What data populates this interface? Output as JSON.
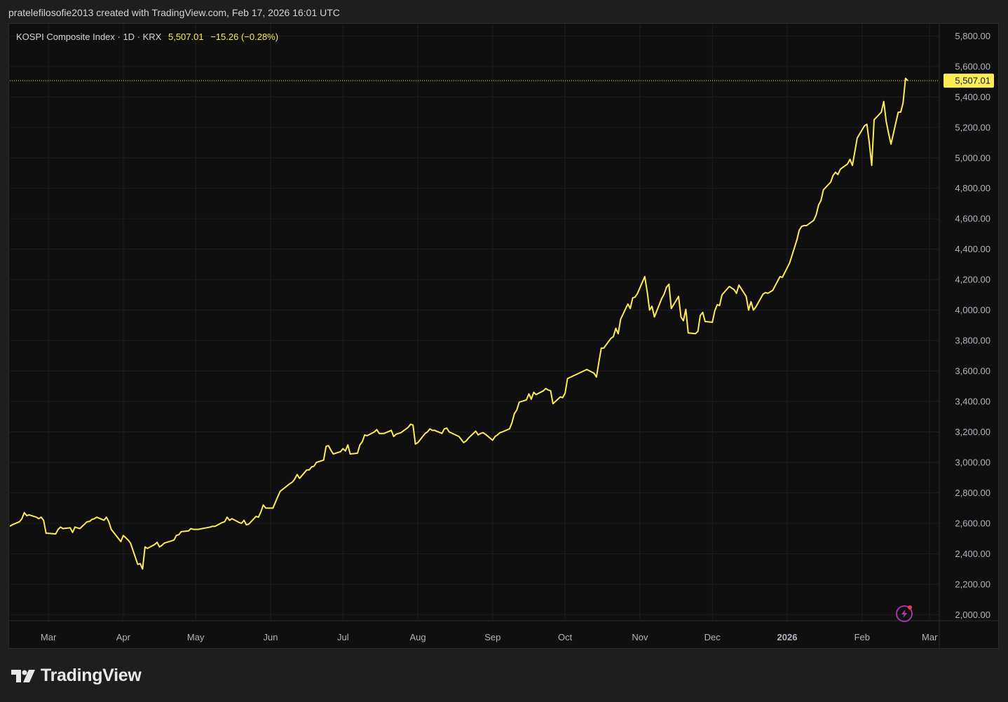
{
  "header": {
    "credit": "pratelefilosofie2013 created with TradingView.com, Feb 17, 2026 16:01 UTC"
  },
  "legend": {
    "symbol": "KOSPI Composite Index · 1D · KRX",
    "last": "5,507.01",
    "change": "−15.26 (−0.28%)"
  },
  "footer": {
    "brand": "TradingView"
  },
  "colors": {
    "line": "#fbeb55",
    "background": "#0f0f0f",
    "grid": "#1f1f1f",
    "axis_text": "#b2b5be",
    "tag_bg": "#fbeb55"
  },
  "icons": {
    "alert": "lightning-bolt-icon"
  },
  "chart_data": {
    "type": "line",
    "title": "KOSPI Composite Index · 1D · KRX",
    "ylim": [
      1960,
      5880
    ],
    "xlim": [
      "2025-02-13",
      "2026-03-05"
    ],
    "y_ticks": [
      2000,
      2200,
      2400,
      2600,
      2800,
      3000,
      3200,
      3400,
      3600,
      3800,
      4000,
      4200,
      4400,
      4600,
      4800,
      5000,
      5200,
      5400,
      5600,
      5800
    ],
    "y_tick_labels": [
      "2,000.00",
      "2,200.00",
      "2,400.00",
      "2,600.00",
      "2,800.00",
      "3,000.00",
      "3,200.00",
      "3,400.00",
      "3,600.00",
      "3,800.00",
      "4,000.00",
      "4,200.00",
      "4,400.00",
      "4,600.00",
      "4,800.00",
      "5,000.00",
      "5,200.00",
      "5,400.00",
      "5,600.00",
      "5,800.00"
    ],
    "x_ticks": [
      {
        "date": "2025-03-01",
        "label": "Mar"
      },
      {
        "date": "2025-04-01",
        "label": "Apr"
      },
      {
        "date": "2025-05-01",
        "label": "May"
      },
      {
        "date": "2025-06-01",
        "label": "Jun"
      },
      {
        "date": "2025-07-01",
        "label": "Jul"
      },
      {
        "date": "2025-08-01",
        "label": "Aug"
      },
      {
        "date": "2025-09-01",
        "label": "Sep"
      },
      {
        "date": "2025-10-01",
        "label": "Oct"
      },
      {
        "date": "2025-11-01",
        "label": "Nov"
      },
      {
        "date": "2025-12-01",
        "label": "Dec"
      },
      {
        "date": "2026-01-01",
        "label": "2026",
        "bold": true
      },
      {
        "date": "2026-02-01",
        "label": "Feb"
      },
      {
        "date": "2026-03-01",
        "label": "Mar"
      }
    ],
    "last_value": 5507.01,
    "last_value_label": "5,507.01",
    "grid": true,
    "series": [
      {
        "points": [
          [
            "2025-02-13",
            2580
          ],
          [
            "2025-02-14",
            2590
          ],
          [
            "2025-02-17",
            2610
          ],
          [
            "2025-02-18",
            2630
          ],
          [
            "2025-02-19",
            2670
          ],
          [
            "2025-02-20",
            2650
          ],
          [
            "2025-02-21",
            2655
          ],
          [
            "2025-02-24",
            2640
          ],
          [
            "2025-02-25",
            2630
          ],
          [
            "2025-02-26",
            2640
          ],
          [
            "2025-02-27",
            2620
          ],
          [
            "2025-02-28",
            2535
          ],
          [
            "2025-03-04",
            2530
          ],
          [
            "2025-03-05",
            2560
          ],
          [
            "2025-03-06",
            2575
          ],
          [
            "2025-03-07",
            2565
          ],
          [
            "2025-03-10",
            2570
          ],
          [
            "2025-03-11",
            2540
          ],
          [
            "2025-03-12",
            2575
          ],
          [
            "2025-03-13",
            2570
          ],
          [
            "2025-03-14",
            2565
          ],
          [
            "2025-03-17",
            2610
          ],
          [
            "2025-03-18",
            2612
          ],
          [
            "2025-03-19",
            2625
          ],
          [
            "2025-03-20",
            2630
          ],
          [
            "2025-03-21",
            2640
          ],
          [
            "2025-03-24",
            2620
          ],
          [
            "2025-03-25",
            2640
          ],
          [
            "2025-03-26",
            2610
          ],
          [
            "2025-03-27",
            2560
          ],
          [
            "2025-03-28",
            2540
          ],
          [
            "2025-03-31",
            2480
          ],
          [
            "2025-04-01",
            2520
          ],
          [
            "2025-04-02",
            2505
          ],
          [
            "2025-04-03",
            2490
          ],
          [
            "2025-04-04",
            2470
          ],
          [
            "2025-04-07",
            2330
          ],
          [
            "2025-04-08",
            2335
          ],
          [
            "2025-04-09",
            2300
          ],
          [
            "2025-04-10",
            2445
          ],
          [
            "2025-04-11",
            2435
          ],
          [
            "2025-04-14",
            2460
          ],
          [
            "2025-04-15",
            2475
          ],
          [
            "2025-04-16",
            2445
          ],
          [
            "2025-04-17",
            2455
          ],
          [
            "2025-04-18",
            2470
          ],
          [
            "2025-04-21",
            2485
          ],
          [
            "2025-04-22",
            2490
          ],
          [
            "2025-04-23",
            2520
          ],
          [
            "2025-04-24",
            2525
          ],
          [
            "2025-04-25",
            2545
          ],
          [
            "2025-04-28",
            2550
          ],
          [
            "2025-04-29",
            2565
          ],
          [
            "2025-04-30",
            2560
          ],
          [
            "2025-05-02",
            2560
          ],
          [
            "2025-05-07",
            2575
          ],
          [
            "2025-05-08",
            2580
          ],
          [
            "2025-05-09",
            2580
          ],
          [
            "2025-05-12",
            2605
          ],
          [
            "2025-05-13",
            2610
          ],
          [
            "2025-05-14",
            2640
          ],
          [
            "2025-05-15",
            2620
          ],
          [
            "2025-05-16",
            2630
          ],
          [
            "2025-05-19",
            2605
          ],
          [
            "2025-05-20",
            2600
          ],
          [
            "2025-05-21",
            2620
          ],
          [
            "2025-05-22",
            2590
          ],
          [
            "2025-05-23",
            2595
          ],
          [
            "2025-05-26",
            2645
          ],
          [
            "2025-05-27",
            2640
          ],
          [
            "2025-05-28",
            2675
          ],
          [
            "2025-05-29",
            2720
          ],
          [
            "2025-05-30",
            2700
          ],
          [
            "2025-06-02",
            2700
          ],
          [
            "2025-06-04",
            2775
          ],
          [
            "2025-06-05",
            2810
          ],
          [
            "2025-06-09",
            2860
          ],
          [
            "2025-06-10",
            2870
          ],
          [
            "2025-06-11",
            2890
          ],
          [
            "2025-06-12",
            2920
          ],
          [
            "2025-06-13",
            2895
          ],
          [
            "2025-06-16",
            2950
          ],
          [
            "2025-06-17",
            2950
          ],
          [
            "2025-06-18",
            2970
          ],
          [
            "2025-06-19",
            2975
          ],
          [
            "2025-06-20",
            3000
          ],
          [
            "2025-06-23",
            3015
          ],
          [
            "2025-06-24",
            3105
          ],
          [
            "2025-06-25",
            3110
          ],
          [
            "2025-06-26",
            3080
          ],
          [
            "2025-06-27",
            3055
          ],
          [
            "2025-06-30",
            3070
          ],
          [
            "2025-07-01",
            3090
          ],
          [
            "2025-07-02",
            3075
          ],
          [
            "2025-07-03",
            3115
          ],
          [
            "2025-07-04",
            3055
          ],
          [
            "2025-07-07",
            3060
          ],
          [
            "2025-07-08",
            3115
          ],
          [
            "2025-07-09",
            3135
          ],
          [
            "2025-07-10",
            3180
          ],
          [
            "2025-07-11",
            3175
          ],
          [
            "2025-07-14",
            3200
          ],
          [
            "2025-07-15",
            3215
          ],
          [
            "2025-07-16",
            3190
          ],
          [
            "2025-07-17",
            3190
          ],
          [
            "2025-07-18",
            3190
          ],
          [
            "2025-07-21",
            3210
          ],
          [
            "2025-07-22",
            3170
          ],
          [
            "2025-07-23",
            3185
          ],
          [
            "2025-07-24",
            3190
          ],
          [
            "2025-07-25",
            3195
          ],
          [
            "2025-07-28",
            3230
          ],
          [
            "2025-07-29",
            3250
          ],
          [
            "2025-07-30",
            3245
          ],
          [
            "2025-07-31",
            3120
          ],
          [
            "2025-08-01",
            3130
          ],
          [
            "2025-08-04",
            3190
          ],
          [
            "2025-08-05",
            3200
          ],
          [
            "2025-08-06",
            3220
          ],
          [
            "2025-08-07",
            3210
          ],
          [
            "2025-08-08",
            3210
          ],
          [
            "2025-08-11",
            3190
          ],
          [
            "2025-08-12",
            3220
          ],
          [
            "2025-08-13",
            3225
          ],
          [
            "2025-08-14",
            3200
          ],
          [
            "2025-08-18",
            3170
          ],
          [
            "2025-08-19",
            3150
          ],
          [
            "2025-08-20",
            3130
          ],
          [
            "2025-08-21",
            3140
          ],
          [
            "2025-08-22",
            3160
          ],
          [
            "2025-08-25",
            3205
          ],
          [
            "2025-08-26",
            3180
          ],
          [
            "2025-08-27",
            3190
          ],
          [
            "2025-08-28",
            3195
          ],
          [
            "2025-08-29",
            3185
          ],
          [
            "2025-09-01",
            3145
          ],
          [
            "2025-09-02",
            3170
          ],
          [
            "2025-09-03",
            3180
          ],
          [
            "2025-09-04",
            3195
          ],
          [
            "2025-09-05",
            3200
          ],
          [
            "2025-09-08",
            3220
          ],
          [
            "2025-09-09",
            3260
          ],
          [
            "2025-09-10",
            3320
          ],
          [
            "2025-09-11",
            3345
          ],
          [
            "2025-09-12",
            3395
          ],
          [
            "2025-09-15",
            3410
          ],
          [
            "2025-09-16",
            3450
          ],
          [
            "2025-09-17",
            3415
          ],
          [
            "2025-09-18",
            3460
          ],
          [
            "2025-09-19",
            3445
          ],
          [
            "2025-09-22",
            3470
          ],
          [
            "2025-09-23",
            3485
          ],
          [
            "2025-09-24",
            3475
          ],
          [
            "2025-09-25",
            3470
          ],
          [
            "2025-09-26",
            3385
          ],
          [
            "2025-09-29",
            3430
          ],
          [
            "2025-09-30",
            3425
          ],
          [
            "2025-10-01",
            3455
          ],
          [
            "2025-10-02",
            3550
          ],
          [
            "2025-10-10",
            3610
          ],
          [
            "2025-10-13",
            3585
          ],
          [
            "2025-10-14",
            3560
          ],
          [
            "2025-10-15",
            3660
          ],
          [
            "2025-10-16",
            3750
          ],
          [
            "2025-10-17",
            3750
          ],
          [
            "2025-10-20",
            3815
          ],
          [
            "2025-10-21",
            3825
          ],
          [
            "2025-10-22",
            3880
          ],
          [
            "2025-10-23",
            3845
          ],
          [
            "2025-10-24",
            3940
          ],
          [
            "2025-10-27",
            4040
          ],
          [
            "2025-10-28",
            4010
          ],
          [
            "2025-10-29",
            4080
          ],
          [
            "2025-10-30",
            4085
          ],
          [
            "2025-10-31",
            4110
          ],
          [
            "2025-11-03",
            4220
          ],
          [
            "2025-11-04",
            4120
          ],
          [
            "2025-11-05",
            4000
          ],
          [
            "2025-11-06",
            4025
          ],
          [
            "2025-11-07",
            3955
          ],
          [
            "2025-11-10",
            4075
          ],
          [
            "2025-11-11",
            4105
          ],
          [
            "2025-11-12",
            4150
          ],
          [
            "2025-11-13",
            4170
          ],
          [
            "2025-11-14",
            4010
          ],
          [
            "2025-11-17",
            4090
          ],
          [
            "2025-11-18",
            3955
          ],
          [
            "2025-11-19",
            3930
          ],
          [
            "2025-11-20",
            4005
          ],
          [
            "2025-11-21",
            3850
          ],
          [
            "2025-11-24",
            3845
          ],
          [
            "2025-11-25",
            3860
          ],
          [
            "2025-11-26",
            3965
          ],
          [
            "2025-11-27",
            3985
          ],
          [
            "2025-11-28",
            3925
          ],
          [
            "2025-12-01",
            3920
          ],
          [
            "2025-12-02",
            3995
          ],
          [
            "2025-12-03",
            4035
          ],
          [
            "2025-12-04",
            4030
          ],
          [
            "2025-12-05",
            4100
          ],
          [
            "2025-12-08",
            4155
          ],
          [
            "2025-12-09",
            4145
          ],
          [
            "2025-12-10",
            4135
          ],
          [
            "2025-12-11",
            4110
          ],
          [
            "2025-12-12",
            4165
          ],
          [
            "2025-12-15",
            4090
          ],
          [
            "2025-12-16",
            4000
          ],
          [
            "2025-12-17",
            4055
          ],
          [
            "2025-12-18",
            4000
          ],
          [
            "2025-12-19",
            4020
          ],
          [
            "2025-12-22",
            4105
          ],
          [
            "2025-12-23",
            4115
          ],
          [
            "2025-12-24",
            4110
          ],
          [
            "2025-12-26",
            4130
          ],
          [
            "2025-12-29",
            4220
          ],
          [
            "2025-12-30",
            4215
          ],
          [
            "2026-01-02",
            4310
          ],
          [
            "2026-01-05",
            4460
          ],
          [
            "2026-01-06",
            4525
          ],
          [
            "2026-01-07",
            4550
          ],
          [
            "2026-01-08",
            4555
          ],
          [
            "2026-01-09",
            4555
          ],
          [
            "2026-01-12",
            4590
          ],
          [
            "2026-01-13",
            4625
          ],
          [
            "2026-01-14",
            4690
          ],
          [
            "2026-01-15",
            4720
          ],
          [
            "2026-01-16",
            4790
          ],
          [
            "2026-01-19",
            4840
          ],
          [
            "2026-01-20",
            4885
          ],
          [
            "2026-01-21",
            4905
          ],
          [
            "2026-01-22",
            4890
          ],
          [
            "2026-01-23",
            4925
          ],
          [
            "2026-01-26",
            4960
          ],
          [
            "2026-01-27",
            4990
          ],
          [
            "2026-01-28",
            4950
          ],
          [
            "2026-01-29",
            5040
          ],
          [
            "2026-01-30",
            5130
          ],
          [
            "2026-02-02",
            5210
          ],
          [
            "2026-02-03",
            5220
          ],
          [
            "2026-02-04",
            5100
          ],
          [
            "2026-02-05",
            4950
          ],
          [
            "2026-02-06",
            5250
          ],
          [
            "2026-02-09",
            5300
          ],
          [
            "2026-02-10",
            5370
          ],
          [
            "2026-02-11",
            5240
          ],
          [
            "2026-02-12",
            5160
          ],
          [
            "2026-02-13",
            5090
          ],
          [
            "2026-02-16",
            5300
          ],
          [
            "2026-02-17",
            5300
          ],
          [
            "2026-02-18",
            5360
          ],
          [
            "2026-02-19",
            5522
          ],
          [
            "2026-02-20",
            5507.01
          ]
        ]
      }
    ]
  }
}
